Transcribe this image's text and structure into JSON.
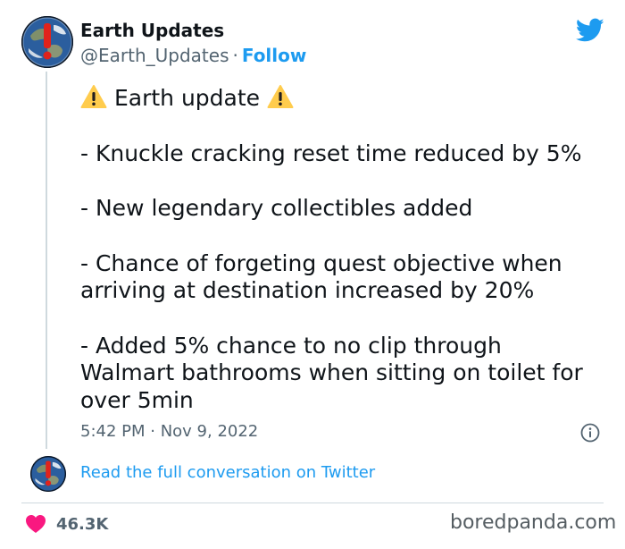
{
  "tweet": {
    "author": {
      "name": "Earth Updates",
      "handle": "@Earth_Updates",
      "separator": "·",
      "follow_label": "Follow",
      "avatar_icon": "earth-globe-warning-icon"
    },
    "brand_icon": "twitter-bird-icon",
    "heading": "Earth update",
    "heading_icon": "warning-sign-icon",
    "lines": [
      "- Knuckle cracking reset time reduced by 5%",
      "- New legendary collectibles added",
      "- Chance of forgeting quest objective when",
      "arriving at destination increased by 20%",
      "- Added 5% chance to no clip through",
      "Walmart bathrooms when sitting on toilet for",
      "over 5min"
    ],
    "timestamp": "5:42 PM · Nov 9, 2022",
    "info_icon": "info-icon"
  },
  "conversation": {
    "link_text": "Read the full conversation on Twitter"
  },
  "footer": {
    "like_count": "46.3K",
    "like_icon": "heart-icon",
    "watermark": "boredpanda.com"
  },
  "colors": {
    "accent": "#1d9bf0",
    "text": "#0f1419",
    "muted": "#536471",
    "heart": "#f91880",
    "warning": "#ffcc4d",
    "divider": "#cfd9de"
  }
}
